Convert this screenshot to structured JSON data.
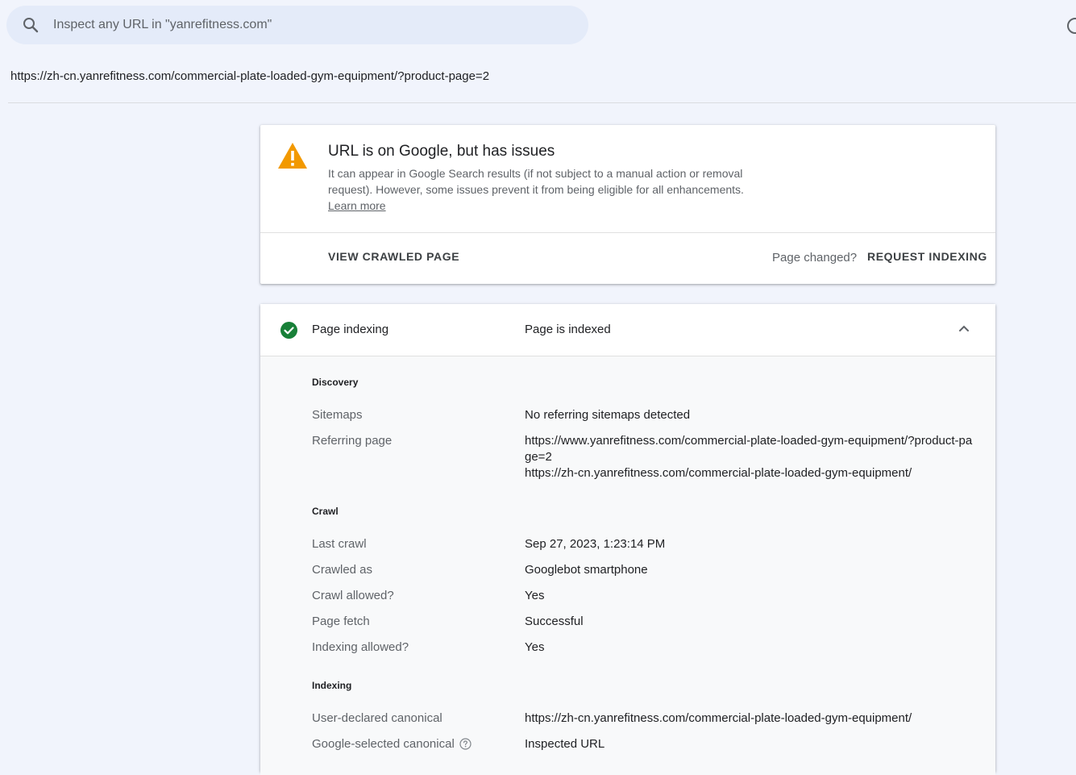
{
  "search": {
    "placeholder": "Inspect any URL in \"yanrefitness.com\"",
    "value": ""
  },
  "inspected_url": "https://zh-cn.yanrefitness.com/commercial-plate-loaded-gym-equipment/?product-page=2",
  "status_card": {
    "title": "URL is on Google, but has issues",
    "description": "It can appear in Google Search results (if not subject to a manual action or removal request). However, some issues prevent it from being eligible for all enhancements.",
    "learn_more": "Learn more",
    "view_crawled_page": "VIEW CRAWLED PAGE",
    "page_changed": "Page changed?",
    "request_indexing": "REQUEST INDEXING",
    "warning_color": "#f29900"
  },
  "indexing_card": {
    "label": "Page indexing",
    "value": "Page is indexed",
    "status_color": "#188038",
    "sections": {
      "discovery": {
        "title": "Discovery",
        "sitemaps_label": "Sitemaps",
        "sitemaps_value": "No referring sitemaps detected",
        "referring_label": "Referring page",
        "referring_values": [
          "https://www.yanrefitness.com/commercial-plate-loaded-gym-equipment/?product-page=2",
          "https://zh-cn.yanrefitness.com/commercial-plate-loaded-gym-equipment/"
        ]
      },
      "crawl": {
        "title": "Crawl",
        "last_crawl_label": "Last crawl",
        "last_crawl_value": "Sep 27, 2023, 1:23:14 PM",
        "crawled_as_label": "Crawled as",
        "crawled_as_value": "Googlebot smartphone",
        "crawl_allowed_label": "Crawl allowed?",
        "crawl_allowed_value": "Yes",
        "page_fetch_label": "Page fetch",
        "page_fetch_value": "Successful",
        "indexing_allowed_label": "Indexing allowed?",
        "indexing_allowed_value": "Yes"
      },
      "indexing": {
        "title": "Indexing",
        "user_canonical_label": "User-declared canonical",
        "user_canonical_value": "https://zh-cn.yanrefitness.com/commercial-plate-loaded-gym-equipment/",
        "google_canonical_label": "Google-selected canonical",
        "google_canonical_value": "Inspected URL"
      }
    }
  }
}
